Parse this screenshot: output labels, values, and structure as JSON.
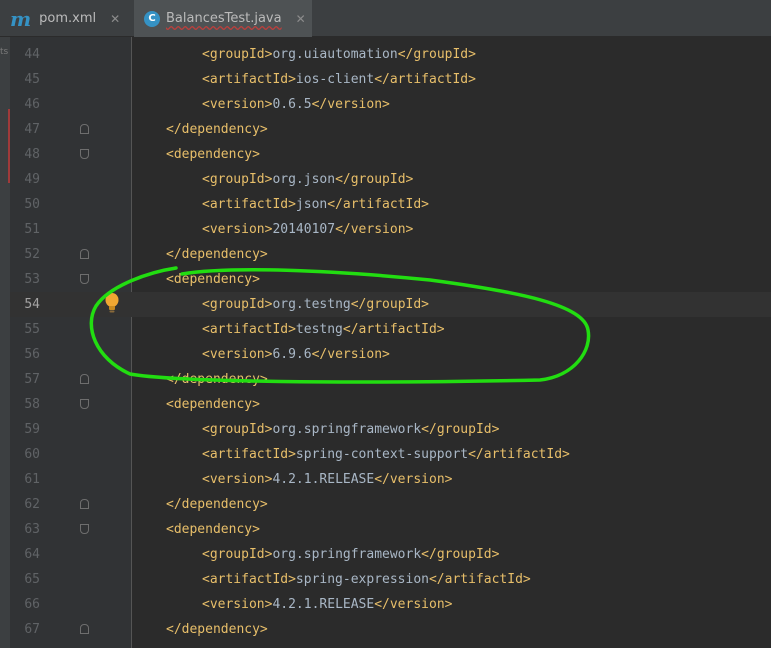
{
  "tabs": [
    {
      "label": "pom.xml",
      "icon": "m",
      "icon_name": "maven-file-icon"
    },
    {
      "label": "BalancesTest.java",
      "icon": "C",
      "icon_name": "java-class-icon"
    }
  ],
  "left_strip_marker": "ts",
  "active_line": 54,
  "lines": [
    {
      "num": "44",
      "indent": 2,
      "open": "<groupId>",
      "text": "org.uiautomation",
      "close": "</groupId>"
    },
    {
      "num": "45",
      "indent": 2,
      "open": "<artifactId>",
      "text": "ios-client",
      "close": "</artifactId>"
    },
    {
      "num": "46",
      "indent": 2,
      "open": "<version>",
      "text": "0.6.5",
      "close": "</version>"
    },
    {
      "num": "47",
      "indent": 1,
      "open": "</dependency>",
      "text": "",
      "close": ""
    },
    {
      "num": "48",
      "indent": 1,
      "open": "<dependency>",
      "text": "",
      "close": ""
    },
    {
      "num": "49",
      "indent": 2,
      "open": "<groupId>",
      "text": "org.json",
      "close": "</groupId>"
    },
    {
      "num": "50",
      "indent": 2,
      "open": "<artifactId>",
      "text": "json",
      "close": "</artifactId>"
    },
    {
      "num": "51",
      "indent": 2,
      "open": "<version>",
      "text": "20140107",
      "close": "</version>"
    },
    {
      "num": "52",
      "indent": 1,
      "open": "</dependency>",
      "text": "",
      "close": ""
    },
    {
      "num": "53",
      "indent": 1,
      "open": "<dependency>",
      "text": "",
      "close": ""
    },
    {
      "num": "54",
      "indent": 2,
      "open": "<groupId>",
      "text": "org.testng",
      "close": "</groupId>"
    },
    {
      "num": "55",
      "indent": 2,
      "open": "<artifactId>",
      "text": "testng",
      "close": "</artifactId>"
    },
    {
      "num": "56",
      "indent": 2,
      "open": "<version>",
      "text": "6.9.6",
      "close": "</version>"
    },
    {
      "num": "57",
      "indent": 1,
      "open": "</dependency>",
      "text": "",
      "close": ""
    },
    {
      "num": "58",
      "indent": 1,
      "open": "<dependency>",
      "text": "",
      "close": ""
    },
    {
      "num": "59",
      "indent": 2,
      "open": "<groupId>",
      "text": "org.springframework",
      "close": "</groupId>"
    },
    {
      "num": "60",
      "indent": 2,
      "open": "<artifactId>",
      "text": "spring-context-support",
      "close": "</artifactId>"
    },
    {
      "num": "61",
      "indent": 2,
      "open": "<version>",
      "text": "4.2.1.RELEASE",
      "close": "</version>"
    },
    {
      "num": "62",
      "indent": 1,
      "open": "</dependency>",
      "text": "",
      "close": ""
    },
    {
      "num": "63",
      "indent": 1,
      "open": "<dependency>",
      "text": "",
      "close": ""
    },
    {
      "num": "64",
      "indent": 2,
      "open": "<groupId>",
      "text": "org.springframework",
      "close": "</groupId>"
    },
    {
      "num": "65",
      "indent": 2,
      "open": "<artifactId>",
      "text": "spring-expression",
      "close": "</artifactId>"
    },
    {
      "num": "66",
      "indent": 2,
      "open": "<version>",
      "text": "4.2.1.RELEASE",
      "close": "</version>"
    },
    {
      "num": "67",
      "indent": 1,
      "open": "</dependency>",
      "text": "",
      "close": ""
    }
  ],
  "colors": {
    "tag": "#e8bf6a",
    "text": "#a9b7c6",
    "line_number": "#606366",
    "annotation_circle": "#22dd11",
    "bulb": "#f0a732"
  }
}
